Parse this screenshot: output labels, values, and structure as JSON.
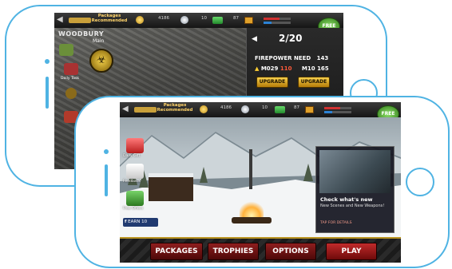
{
  "colors": {
    "device_outline": "#4fb3e3",
    "accent_gold": "#f7cf4c",
    "button_red": "#8e1e1e"
  },
  "topbar": {
    "packages_line1": "Packages",
    "packages_line2": "Recommended",
    "gold_count": "4186",
    "silver_count": "10",
    "cash_count": "87",
    "free_label": "FREE"
  },
  "back_screen": {
    "map_title": "WOODBURY",
    "main_label": "Main",
    "daily_task_label": "Daily Task",
    "upgrade": {
      "counter": "2/20",
      "firepower_label": "FIREPOWER NEED",
      "firepower_value": "143",
      "weapon1_name": "M029",
      "weapon1_value": "110",
      "weapon2_name": "M10",
      "weapon2_value": "165",
      "upgrade_label": "UPGRADE"
    }
  },
  "front_screen": {
    "left_icons": [
      {
        "label": "Daily Gift",
        "icon": "gift-calendar-icon"
      },
      {
        "label": "Feedback",
        "icon": "feedback-icon"
      },
      {
        "label": "Free Offers",
        "icon": "offers-icon"
      }
    ],
    "earn_label": "EARN 10",
    "news": {
      "title": "Check what's new",
      "subtitle": "New Scenes and New Weapons!",
      "tap": "TAP FOR DETAILS"
    },
    "menu": {
      "packages": "PACKAGES",
      "trophies": "TROPHIES",
      "options": "OPTIONS",
      "play": "PLAY"
    }
  }
}
